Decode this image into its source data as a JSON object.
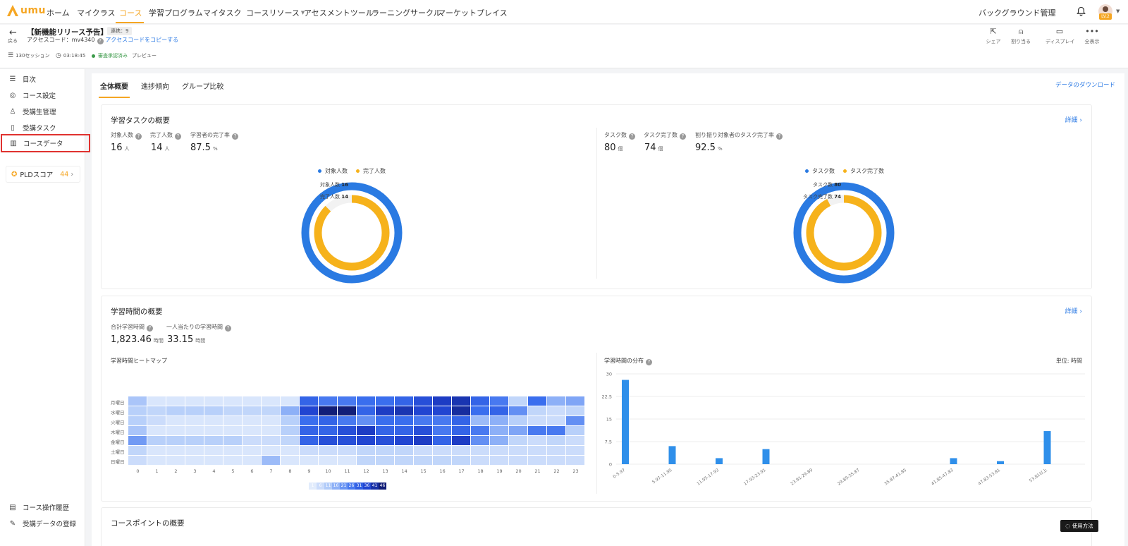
{
  "nav": {
    "logo": "umu",
    "items": [
      "ホーム",
      "マイクラス",
      "コース",
      "学習プログラム",
      "マイタスク",
      "コースリソース",
      "アセスメントツール",
      "ラーニングサークル",
      "マーケットプレイス"
    ],
    "right_label": "バックグラウンド管理",
    "avatar_badge": "LV.2"
  },
  "course": {
    "back_label": "戻る",
    "title": "【新機能リリース予告】",
    "tag": "連携：9",
    "access_code": "アクセスコード：mv4340",
    "copy_link": "アクセスコードをコピーする",
    "sessions": "130セッション",
    "duration": "03:18:45",
    "status": "審査承認済み",
    "preview": "プレビュー",
    "tools": [
      "シェア",
      "割り当る",
      "ディスプレイ",
      "全表示"
    ]
  },
  "sidebar": {
    "items": [
      "目次",
      "コース設定",
      "受講生管理",
      "受講タスク",
      "コースデータ"
    ],
    "pld_label": "PLDスコア",
    "pld_score": "44",
    "bottom": [
      "コース操作履歴",
      "受講データの登録"
    ]
  },
  "tabs": [
    "全体概要",
    "進捗傾向",
    "グループ比較"
  ],
  "download": "データのダウンロード",
  "task_card": {
    "title": "学習タスクの概要",
    "detail": "詳細",
    "left_stats": [
      {
        "label": "対象人数",
        "value": "16",
        "unit": "人"
      },
      {
        "label": "完了人数",
        "value": "14",
        "unit": "人"
      },
      {
        "label": "学習者の完了率",
        "value": "87.5",
        "unit": "%"
      }
    ],
    "right_stats": [
      {
        "label": "タスク数",
        "value": "80",
        "unit": "個"
      },
      {
        "label": "タスク完了数",
        "value": "74",
        "unit": "個"
      },
      {
        "label": "割り振り対象者のタスク完了率",
        "value": "92.5",
        "unit": "%"
      }
    ],
    "left_legend": [
      "対象人数",
      "完了人数"
    ],
    "right_legend": [
      "タスク数",
      "タスク完了数"
    ],
    "left_ring": {
      "outer_label": "対象人数",
      "outer_value": "16",
      "inner_label": "完了人数",
      "inner_value": "14",
      "outer_fraction": 1.0,
      "inner_fraction": 0.875
    },
    "right_ring": {
      "outer_label": "タスク数",
      "outer_value": "80",
      "inner_label": "タスク完了数",
      "inner_value": "74",
      "outer_fraction": 1.0,
      "inner_fraction": 0.925
    },
    "colors": {
      "outer": "#2a7ae2",
      "inner": "#f6b21b",
      "track": "#f2f2f2"
    }
  },
  "time_card": {
    "title": "学習時間の概要",
    "detail": "詳細",
    "stats": [
      {
        "label": "合計学習時間",
        "value": "1,823.46",
        "unit": "時間"
      },
      {
        "label": "一人当たりの学習時間",
        "value": "33.15",
        "unit": "時間"
      }
    ],
    "heatmap_title": "学習時間ヒートマップ",
    "distribution_title": "学習時間の分布",
    "unit_label": "単位: 時間",
    "scale_labels": [
      "1",
      "6",
      "11",
      "16",
      "21",
      "26",
      "31",
      "36",
      "41",
      "46"
    ]
  },
  "points_card": {
    "title": "コースポイントの概要"
  },
  "help": "使用方法",
  "chart_data": [
    {
      "type": "heatmap",
      "title": "学習時間ヒートマップ",
      "rows": [
        "月曜日",
        "水曜日",
        "火曜日",
        "木曜日",
        "金曜日",
        "土曜日",
        "日曜日"
      ],
      "columns": [
        "0",
        "1",
        "2",
        "3",
        "4",
        "5",
        "6",
        "7",
        "8",
        "9",
        "10",
        "11",
        "12",
        "13",
        "14",
        "15",
        "16",
        "17",
        "18",
        "19",
        "20",
        "21",
        "22",
        "23"
      ],
      "values": [
        [
          12,
          3,
          3,
          3,
          3,
          3,
          3,
          3,
          3,
          30,
          26,
          26,
          28,
          28,
          30,
          34,
          38,
          40,
          30,
          26,
          8,
          28,
          16,
          18
        ],
        [
          10,
          8,
          10,
          10,
          10,
          8,
          8,
          8,
          16,
          36,
          46,
          46,
          30,
          38,
          40,
          36,
          36,
          42,
          28,
          30,
          22,
          8,
          6,
          8
        ],
        [
          10,
          6,
          3,
          3,
          3,
          3,
          3,
          3,
          10,
          28,
          30,
          26,
          22,
          28,
          28,
          26,
          26,
          30,
          14,
          16,
          10,
          6,
          6,
          22
        ],
        [
          12,
          3,
          3,
          3,
          3,
          3,
          3,
          3,
          10,
          30,
          30,
          34,
          38,
          30,
          30,
          34,
          26,
          30,
          26,
          16,
          18,
          26,
          26,
          10
        ],
        [
          20,
          10,
          10,
          10,
          10,
          10,
          6,
          6,
          8,
          30,
          34,
          34,
          36,
          34,
          36,
          38,
          30,
          38,
          22,
          16,
          8,
          6,
          8,
          6
        ],
        [
          8,
          3,
          3,
          3,
          3,
          3,
          3,
          3,
          3,
          6,
          6,
          6,
          8,
          8,
          8,
          6,
          6,
          6,
          6,
          6,
          6,
          6,
          6,
          6
        ],
        [
          6,
          3,
          3,
          3,
          3,
          3,
          3,
          14,
          3,
          3,
          3,
          3,
          8,
          8,
          8,
          8,
          8,
          8,
          6,
          6,
          6,
          6,
          6,
          6
        ]
      ],
      "scale": [
        1,
        46
      ]
    },
    {
      "type": "bar",
      "title": "学習時間の分布",
      "categories": [
        "0-5.97",
        "5.97-11.95",
        "11.95-17.93",
        "17.93-23.91",
        "23.91-29.89",
        "29.89-35.87",
        "35.87-41.85",
        "41.85-47.83",
        "47.83-53.81",
        "53.81以上"
      ],
      "values": [
        28,
        6,
        2,
        5,
        0,
        0,
        0,
        2,
        1,
        11
      ],
      "yticks": [
        "0",
        "7.5",
        "15",
        "22.5",
        "30"
      ],
      "ylim": [
        0,
        30
      ],
      "color": "#2f8fea"
    }
  ]
}
